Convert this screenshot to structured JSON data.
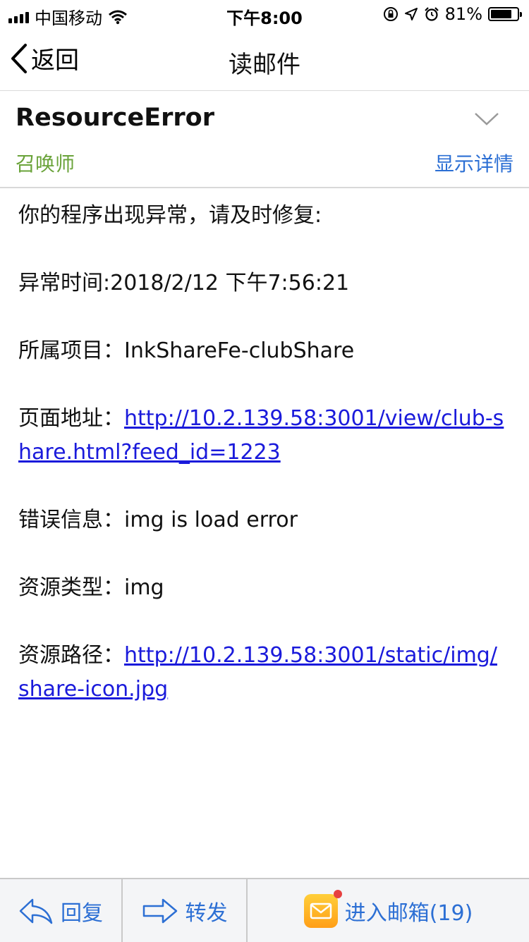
{
  "status_bar": {
    "carrier": "中国移动",
    "time": "下午8:00",
    "battery_percent_text": "81%",
    "battery_level": 0.81
  },
  "nav": {
    "back_label": "返回",
    "title": "读邮件"
  },
  "mail": {
    "subject": "ResourceError",
    "sender": "召唤师",
    "details_label": "显示详情",
    "intro": "你的程序出现异常，请及时修复:",
    "time_line": "异常时间:2018/2/12 下午7:56:21",
    "project_label": "所属项目：",
    "project_value": "InkShareFe-clubShare",
    "page_label": "页面地址：",
    "page_url": "http://10.2.139.58:3001/view/club-share.html?feed_id=1223",
    "error_label": "错误信息：",
    "error_value": "img is load error",
    "resource_type_label": "资源类型：",
    "resource_type_value": "img",
    "resource_path_label": "资源路径：",
    "resource_path_url": "http://10.2.139.58:3001/static/img/share-icon.jpg"
  },
  "bottom_bar": {
    "reply_label": "回复",
    "forward_label": "转发",
    "inbox_label": "进入邮箱(19)"
  },
  "colors": {
    "accent_blue": "#2c6fd4",
    "link_blue": "#1a1adb",
    "sender_green": "#6aa33a"
  }
}
